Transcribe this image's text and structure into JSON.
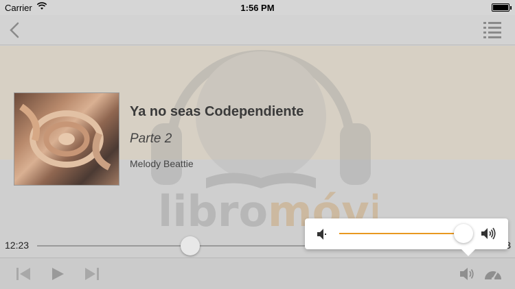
{
  "status_bar": {
    "carrier": "Carrier",
    "time": "1:56 PM"
  },
  "nav": {
    "back_icon": "chevron-left-icon",
    "playlist_icon": "list-icon"
  },
  "watermark": {
    "text_a": "libro",
    "text_b": "móvil"
  },
  "book": {
    "title": "Ya no seas Codependiente",
    "part": "Parte 2",
    "author": "Melody Beattie"
  },
  "progress": {
    "elapsed": "12:23",
    "remaining": "3",
    "fraction": 0.36
  },
  "volume": {
    "level": 0.95,
    "accent_color": "#e89820"
  },
  "controls": {
    "prev_icon": "skip-back-icon",
    "play_icon": "play-icon",
    "next_icon": "skip-forward-icon",
    "volume_icon": "speaker-icon",
    "speed_icon": "speedometer-icon"
  }
}
